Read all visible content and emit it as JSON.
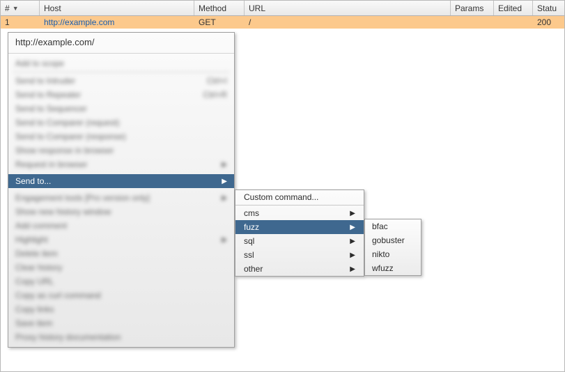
{
  "table": {
    "headers": {
      "num": "#",
      "host": "Host",
      "method": "Method",
      "url": "URL",
      "params": "Params",
      "edited": "Edited",
      "status": "Statu"
    },
    "sort_indicator": "▼",
    "rows": [
      {
        "num": "1",
        "host": "http://example.com",
        "method": "GET",
        "url": "/",
        "params": "",
        "edited": "",
        "status": "200"
      }
    ]
  },
  "context_menu": {
    "title": "http://example.com/",
    "blurred_above": [
      "Add to scope",
      "",
      "Send to Intruder",
      "Send to Repeater",
      "Send to Sequencer",
      "Send to Comparer (request)",
      "Send to Comparer (response)",
      "Show response in browser",
      "Request in browser"
    ],
    "highlighted": {
      "label": "Send to...",
      "has_submenu": true
    },
    "blurred_below": [
      "Engagement tools [Pro version only]",
      "Show new history window",
      "Add comment",
      "Highlight",
      "Delete item",
      "Clear history",
      "Copy URL",
      "Copy as curl command",
      "Copy links",
      "Save item",
      "Proxy history documentation"
    ]
  },
  "submenu1": {
    "items": [
      {
        "label": "Custom command...",
        "has_submenu": false,
        "highlight": false,
        "separator_after": true
      },
      {
        "label": "cms",
        "has_submenu": true,
        "highlight": false
      },
      {
        "label": "fuzz",
        "has_submenu": true,
        "highlight": true
      },
      {
        "label": "sql",
        "has_submenu": true,
        "highlight": false
      },
      {
        "label": "ssl",
        "has_submenu": true,
        "highlight": false
      },
      {
        "label": "other",
        "has_submenu": true,
        "highlight": false
      }
    ]
  },
  "submenu2": {
    "items": [
      {
        "label": "bfac"
      },
      {
        "label": "gobuster"
      },
      {
        "label": "nikto"
      },
      {
        "label": "wfuzz"
      }
    ]
  },
  "glyphs": {
    "submenu_arrow": "▶"
  }
}
